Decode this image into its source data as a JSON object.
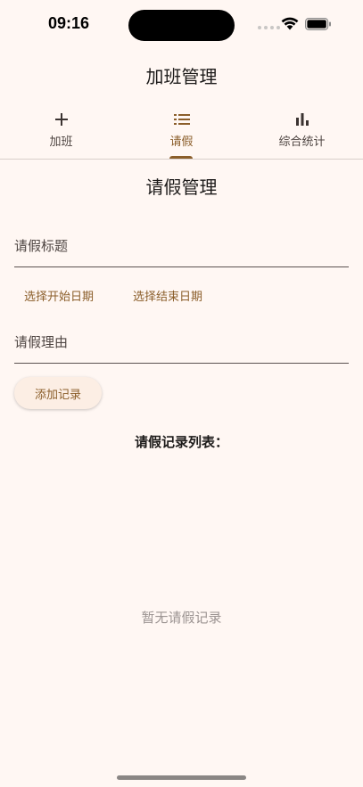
{
  "status_bar": {
    "time": "09:16"
  },
  "app_bar": {
    "title": "加班管理"
  },
  "tabs": [
    {
      "label": "加班",
      "icon": "add-icon"
    },
    {
      "label": "请假",
      "icon": "list-icon",
      "active": true
    },
    {
      "label": "综合统计",
      "icon": "bar-chart-icon"
    }
  ],
  "leave": {
    "section_title": "请假管理",
    "title_placeholder": "请假标题",
    "start_date_label": "选择开始日期",
    "end_date_label": "选择结束日期",
    "reason_placeholder": "请假理由",
    "add_label": "添加记录",
    "list_title": "请假记录列表：",
    "empty_text": "暂无请假记录"
  },
  "colors": {
    "background": "#fff7f3",
    "accent": "#8b5e2a",
    "button_bg": "#fceee4"
  }
}
